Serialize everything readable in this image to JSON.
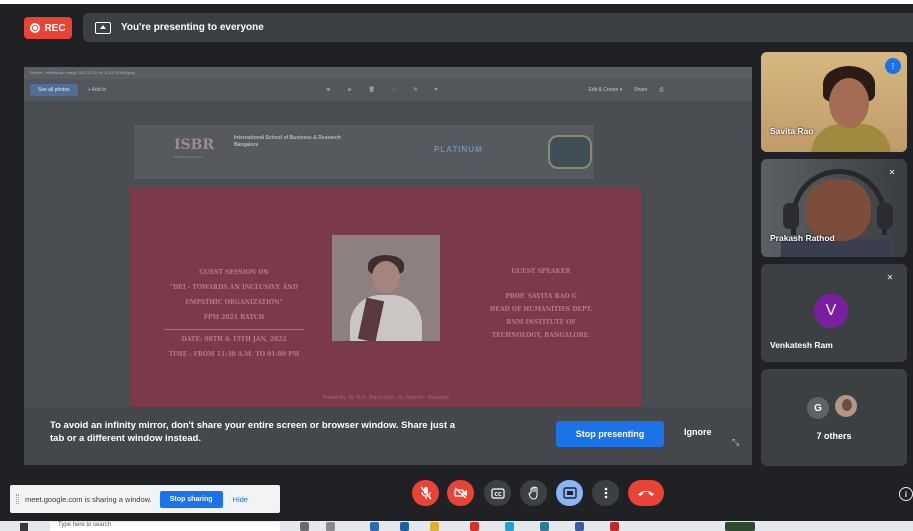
{
  "topbar": {
    "rec_label": "REC",
    "presenting_text": "You're presenting to everyone"
  },
  "shared_screen": {
    "photos_title": "Photos - WhatsApp Image 2022-01-21 at 11.43.01 AM.jpeg",
    "see_all": "See all photos",
    "add_to": "+ Add to",
    "edit_create": "Edit & Create ▾",
    "share": "Share",
    "document": {
      "logo_text": "ISBR",
      "logo_sub": "BUSINESS SCHOOL",
      "institute_name": "International School of Business & Research Bangalore",
      "partner_text": "PLATINUM"
    },
    "poster": {
      "left_lines": [
        "GUEST SESSION ON",
        "\"DEI - TOWARDS AN INCLUSIVE AND",
        "EMPATHIC ORGANIZATION\"",
        "FPM 2021 BATCH"
      ],
      "date_line": "DATE: 08TH & 15TH JAN, 2022",
      "time_line": "TIME : FROM 11:30 A.M. TO 01:00 PM",
      "right_heading": "GUEST SPEAKER",
      "right_lines": [
        "PROF. SAVITA RAO G",
        "HEAD OF HUMANITIES DEPT.",
        "BNM INSTITUTE OF",
        "TECHNOLOGY, BANGALORE."
      ],
      "hosted_by": "Hosted By: Dr. M.R. Jhansi Rani, Dy. Director - Research"
    }
  },
  "mirror_warning": {
    "text": "To avoid an infinity mirror, don't share your entire screen or browser window. Share just a tab or a different window instead.",
    "stop_presenting": "Stop presenting",
    "ignore": "Ignore"
  },
  "participants": [
    {
      "name": "Savita Rao"
    },
    {
      "name": "Prakash Rathod"
    },
    {
      "name": "Venkatesh Ram",
      "initial": "V"
    },
    {
      "name": "7 others",
      "initial": "G"
    }
  ],
  "share_notice": {
    "text": "meet.google.com is sharing a window.",
    "stop_sharing": "Stop sharing",
    "hide": "Hide"
  },
  "taskbar": {
    "search_placeholder": "Type here to search"
  },
  "colors": {
    "rec_red": "#ea4335",
    "accent_blue": "#1a73e8",
    "avatar_purple": "#7b1fa2",
    "poster_maroon": "#7b3a49"
  }
}
